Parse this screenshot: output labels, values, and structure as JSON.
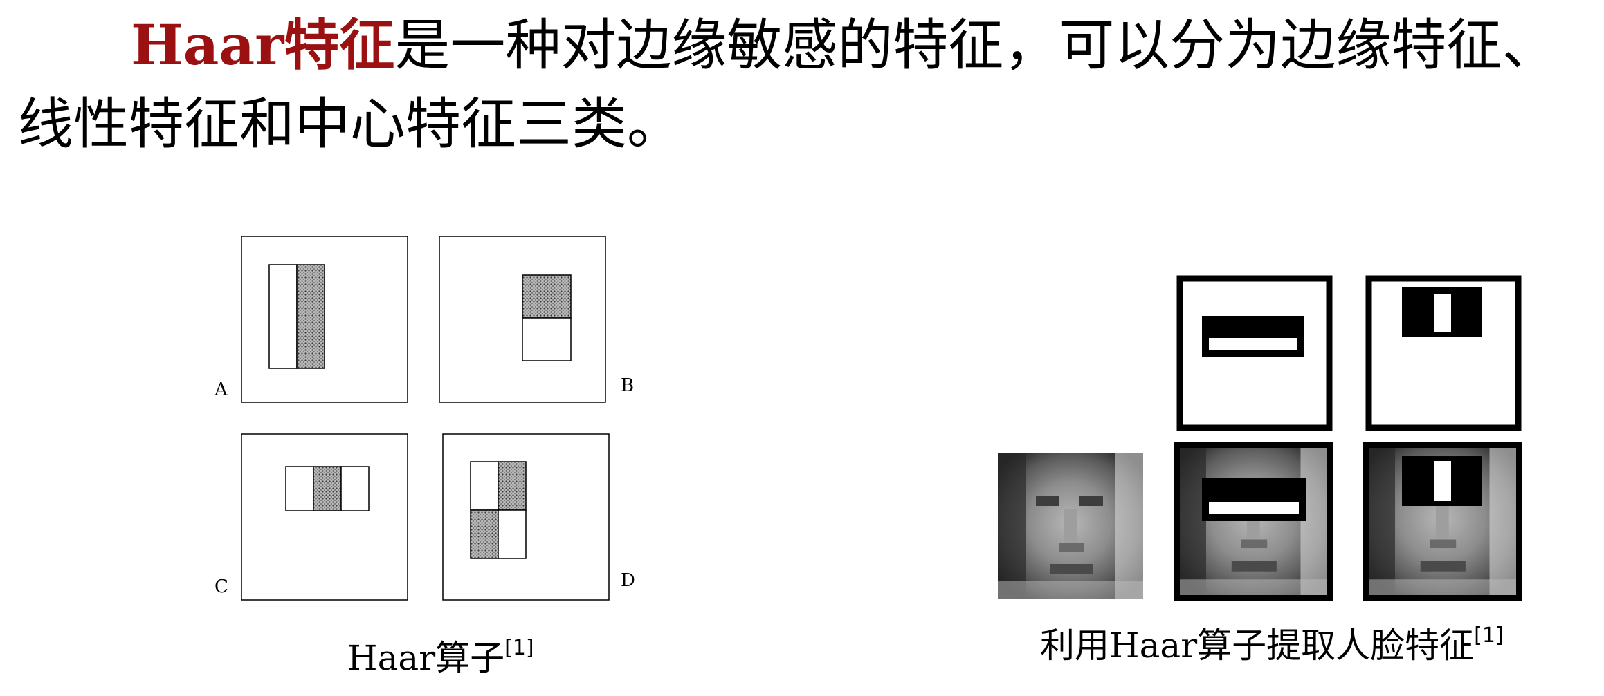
{
  "intro": {
    "highlight": "Haar特征",
    "text": "是一种对边缘敏感的特征，可以分为边缘特征、线性特征和中心特征三类。"
  },
  "left_figure": {
    "panel_labels": [
      "A",
      "B",
      "C",
      "D"
    ],
    "caption": "Haar算子",
    "caption_ref": "[1]"
  },
  "right_figure": {
    "caption": "利用Haar算子提取人脸特征",
    "caption_ref": "[1]"
  },
  "colors": {
    "highlight": "#9b1010",
    "feature_shade": "#8c8c8c"
  }
}
